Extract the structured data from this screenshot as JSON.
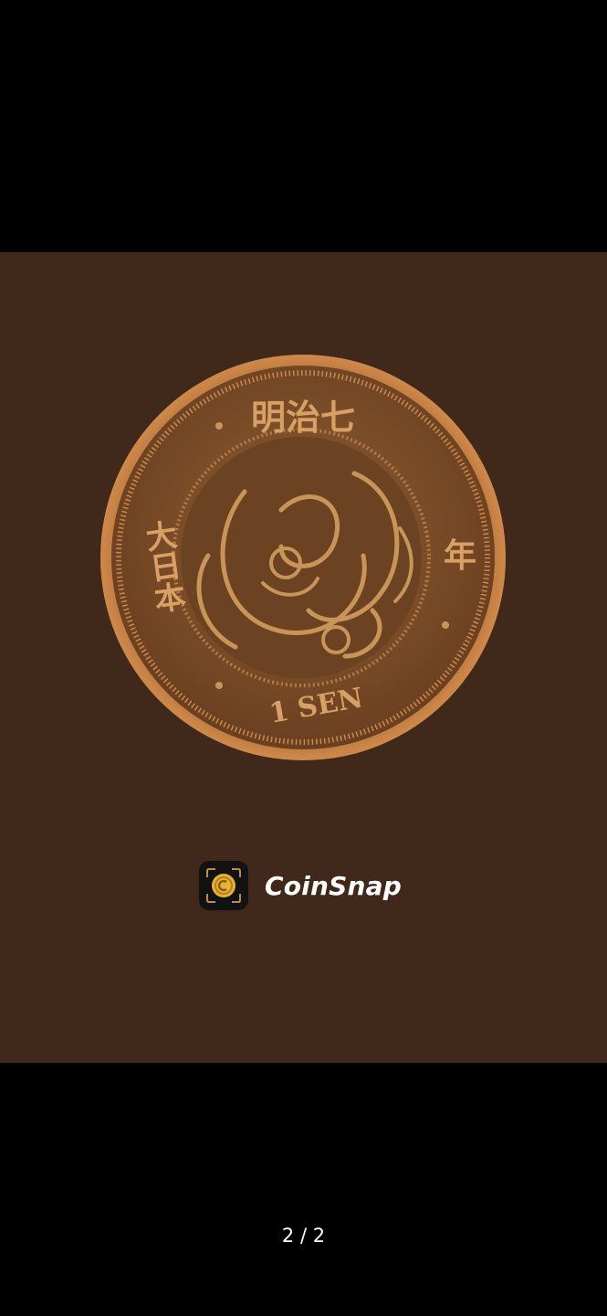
{
  "viewer": {
    "brand_name": "CoinSnap",
    "page_counter": "2 / 2"
  },
  "photo": {
    "coin_legend_top": "明治七",
    "coin_legend_left": "大日本",
    "coin_legend_right": "年",
    "coin_denomination": "1 SEN"
  },
  "colors": {
    "screen_background": "#000000",
    "photo_background": "#40291a",
    "coin_copper": "#9a6434",
    "brand_text": "#ffffff"
  }
}
